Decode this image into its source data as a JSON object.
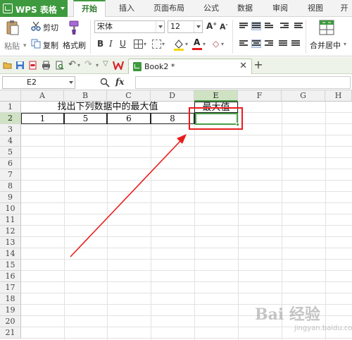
{
  "app": {
    "title": "WPS 表格"
  },
  "menu_tabs": [
    "开始",
    "插入",
    "页面布局",
    "公式",
    "数据",
    "审阅",
    "视图",
    "开"
  ],
  "active_tab": "开始",
  "ribbon": {
    "paste_label": "粘贴",
    "cut_label": "剪切",
    "copy_label": "复制",
    "format_painter_label": "格式刷",
    "font_name": "宋体",
    "font_size": "12",
    "merge_center_label": "合并居中"
  },
  "document": {
    "tab_name": "Book2 *"
  },
  "formula_bar": {
    "cell_reference": "E2",
    "fx_label": "fx",
    "formula": ""
  },
  "sheet": {
    "columns": [
      "A",
      "B",
      "C",
      "D",
      "E",
      "F",
      "G",
      "H"
    ],
    "selected_column": "E",
    "rows": [
      "1",
      "2",
      "3",
      "4",
      "5",
      "6",
      "7",
      "8",
      "9",
      "10",
      "11",
      "12",
      "13",
      "14",
      "15",
      "16",
      "17",
      "18",
      "19",
      "20",
      "21"
    ],
    "selected_row": "2",
    "header_text": "找出下列数据中的最大值",
    "result_header": "最大值",
    "values": [
      "1",
      "5",
      "6",
      "8"
    ],
    "result_value": ""
  },
  "annotation": {
    "color": "#ea1c1c"
  },
  "watermark": {
    "text1": "Bai 经验",
    "text2": "jingyan.baidu.com"
  },
  "colors": {
    "accent": "#3e9a3e",
    "selection": "#4a9e4a"
  }
}
